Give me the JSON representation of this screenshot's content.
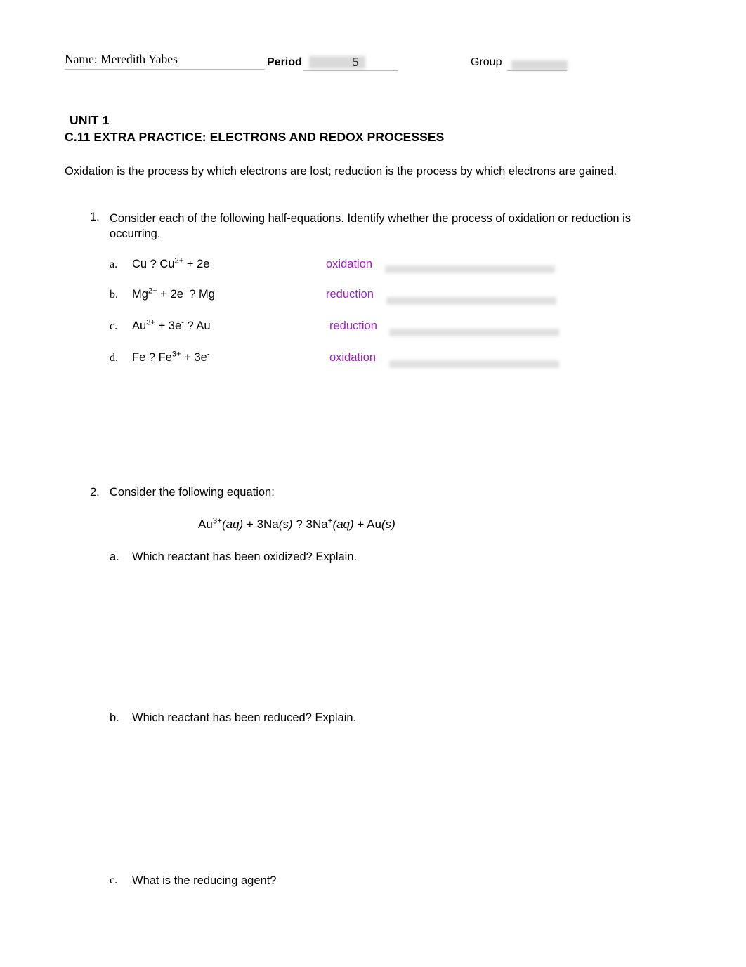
{
  "header": {
    "name_label": "Name: Meredith Yabes",
    "period_label": "Period",
    "period_value": "5",
    "group_label": "Group"
  },
  "titles": {
    "unit": "UNIT 1",
    "main": "C.11 EXTRA PRACTICE: ELECTRONS AND REDOX PROCESSES"
  },
  "intro": "Oxidation is the process by which electrons are lost; reduction is the process by which electrons are gained.",
  "question1": {
    "number": "1.",
    "text": "Consider each of the following half-equations. Identify whether the process of oxidation or reduction is occurring.",
    "items": [
      {
        "letter": "a.",
        "equation_html": "Cu ?  Cu<sup>2+</sup> + 2e<sup>-</sup>",
        "answer": "oxidation"
      },
      {
        "letter": "b.",
        "equation_html": "Mg<sup>2+</sup> + 2e<sup>-</sup> ?  Mg",
        "answer": "reduction"
      },
      {
        "letter": "c.",
        "equation_html": "Au<sup>3+</sup> + 3e<sup>-</sup> ?  Au",
        "answer": "reduction"
      },
      {
        "letter": "d.",
        "equation_html": "Fe ?  Fe<sup>3+</sup> + 3e<sup>-</sup>",
        "answer": "oxidation"
      }
    ]
  },
  "question2": {
    "number": "2.",
    "text": "Consider the following equation:",
    "equation_html": "Au<sup>3+</sup><i>(aq)</i> + 3Na<i>(s)</i> ?  3Na<sup>+</sup><i>(aq)</i> + Au<i>(s)</i>",
    "items": [
      {
        "letter": "a.",
        "text": "Which reactant has been oxidized? Explain."
      },
      {
        "letter": "b.",
        "text": "Which reactant has been reduced? Explain."
      },
      {
        "letter": "c.",
        "text": "What is the reducing agent?"
      }
    ]
  },
  "colors": {
    "answer_text": "#a020c0",
    "rule_line": "#b9b9b9",
    "redaction": "#d9d9d9"
  }
}
